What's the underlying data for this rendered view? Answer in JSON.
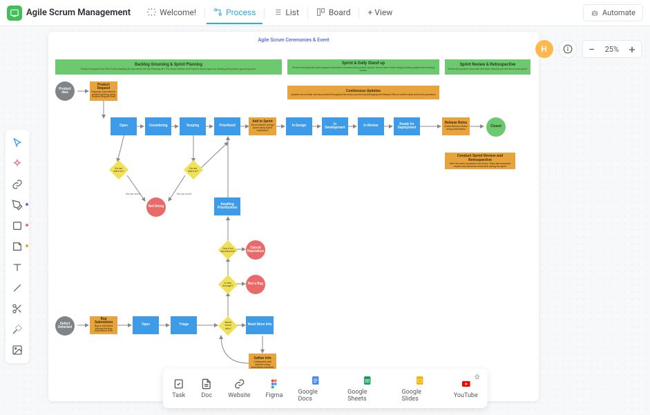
{
  "app": {
    "title": "Agile Scrum Management"
  },
  "tabs": {
    "welcome": "Welcome!",
    "process": "Process",
    "list": "List",
    "board": "Board",
    "addview": "+ View"
  },
  "automate": "Automate",
  "avatar_initial": "H",
  "zoom": {
    "value": "25%"
  },
  "frame": {
    "title": "Agile Scrum Ceremonies & Event"
  },
  "headers": {
    "backlog": {
      "title": "Backlog Grooming & Sprint Planning",
      "sub": "Product requests from the Product Backlog for any active UX Key Planning list. The Scrum Master and Product Owner agree on backlog and product grooming work."
    },
    "sprint": {
      "title": "Sprint & Daily Stand-up",
      "sub": "Product development planning and committee members and product sprints. Scrum team meets daily providing update and blocking issues."
    },
    "review": {
      "title": "Sprint Review & Retrospective",
      "sub": "Review the product increment and team velocity and decide on next sprint."
    }
  },
  "bars": {
    "updates": {
      "title": "Continuous Updates",
      "sub": "Updates as a review can be provided throughout the scrum process by leveraging the Release Plan to confirm task and event processes"
    },
    "retro": {
      "title": "Conduct Sprint Review and Retrospective",
      "sub": "After the work completes, the Scrum Team demonstrates results and discusses what went during the sprint"
    }
  },
  "circles": {
    "idea": "Product Idea",
    "defect": "Defect Detected",
    "closed": "Closed",
    "notdoing": "Not Doing",
    "cancelrep": "Cancel Reproduce",
    "notabug": "Not a Bug",
    "moreinfo": "Need More Info"
  },
  "orange": {
    "prodreq": {
      "title": "Product Request",
      "sub": "Requests submitted to product backlog using Product Request form"
    },
    "bugsub": {
      "title": "Bug Submission",
      "sub": "Bug is submitted through the Bug Submission form"
    },
    "addsprint": {
      "title": "Add to Sprint",
      "sub": "Scrum Master assign sprint using Sprint Dashboard"
    },
    "relnotes": {
      "title": "Release Notes",
      "sub": "Create Release Notes using Automation"
    },
    "gather": {
      "title": "Gather Info",
      "sub": "Collaborate with reporter using automated comment"
    }
  },
  "blue": {
    "open": "Open",
    "considering": "Considering",
    "scoping": "Scoping",
    "prioritized": "Prioritized",
    "indesign": "In Design",
    "indev": "In Development",
    "inreview": "In Review",
    "ready": "Ready for Deployment",
    "awaiting": "Awaiting Prioritization",
    "bopen": "Open",
    "triage": "Triage"
  },
  "diamonds": {
    "d1": "Do we want to?",
    "d2": "Do we want to?",
    "d3": "Can it be reproduced?",
    "d4": "Is this enough?",
    "d5": "Need more info?"
  },
  "arrowlabels": {
    "no1": "No we won't",
    "no2": "No we won't"
  },
  "dock": {
    "task": "Task",
    "doc": "Doc",
    "website": "Website",
    "figma": "Figma",
    "gdocs": "Google Docs",
    "gsheets": "Google Sheets",
    "gslides": "Google Slides",
    "youtube": "YouTube"
  }
}
